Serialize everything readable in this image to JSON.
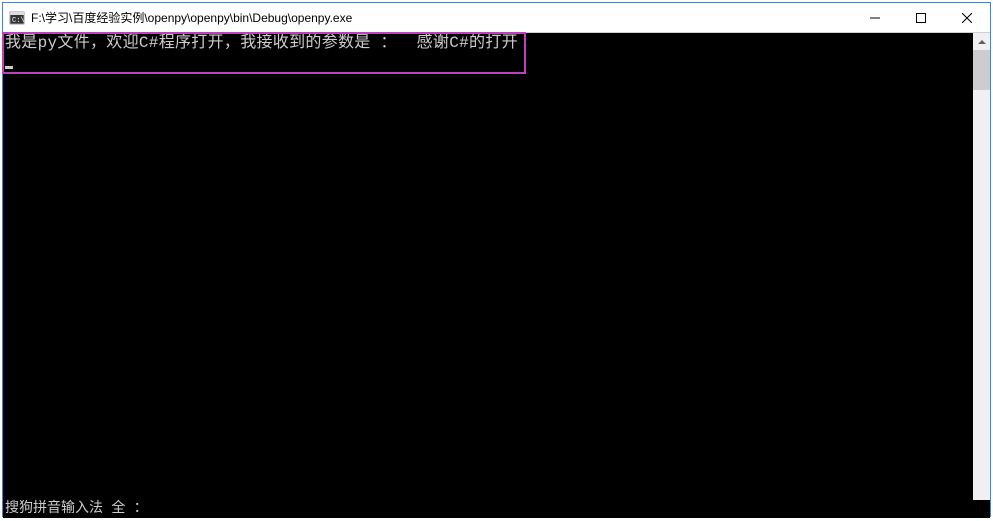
{
  "window": {
    "title": "F:\\学习\\百度经验实例\\openpy\\openpy\\bin\\Debug\\openpy.exe"
  },
  "console": {
    "line1": "我是py文件，欢迎C#程序打开，我接收到的参数是 ：  感谢C#的打开"
  },
  "ime": {
    "text": "搜狗拼音输入法  全 ："
  },
  "controls": {
    "minimize": "minimize",
    "maximize": "maximize",
    "close": "close"
  }
}
